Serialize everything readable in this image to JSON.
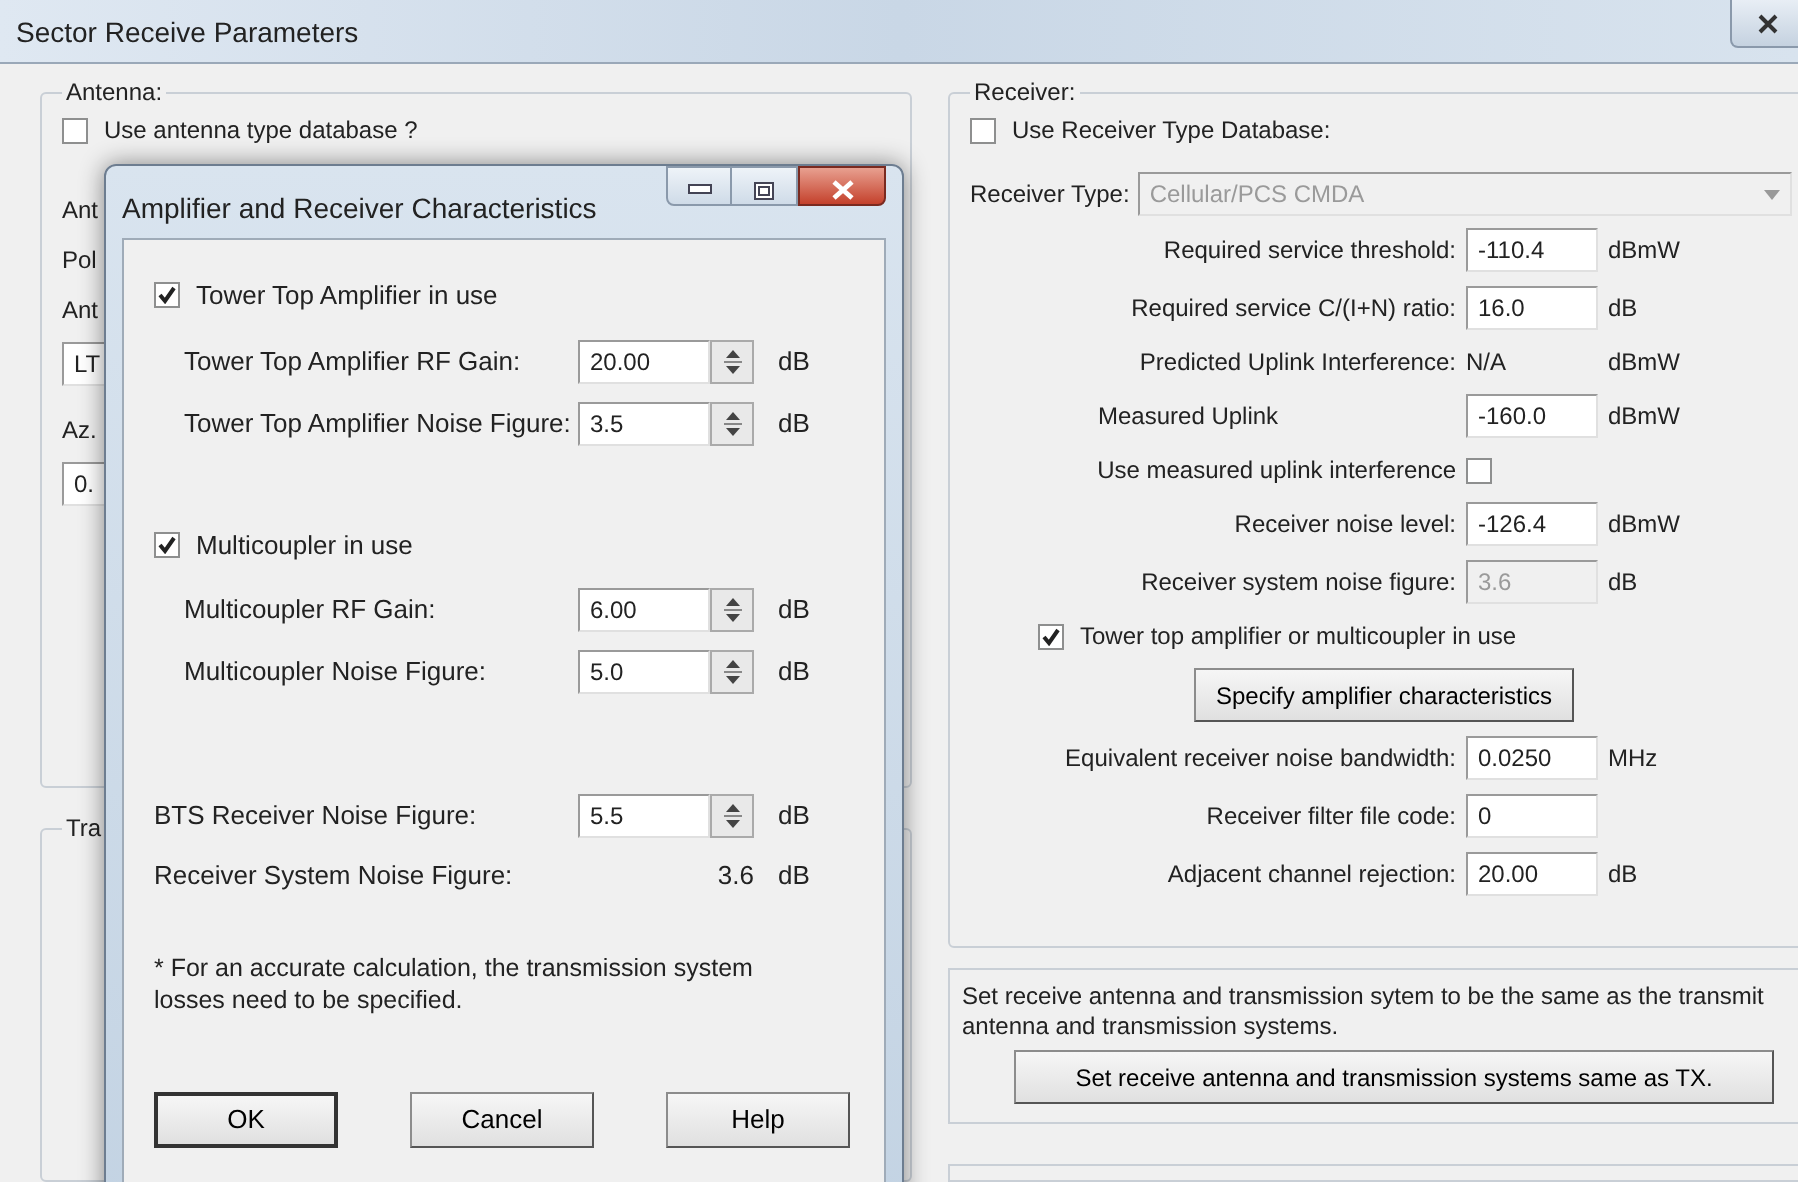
{
  "window": {
    "title": "Sector Receive Parameters"
  },
  "antenna": {
    "legend": "Antenna:",
    "use_database": {
      "label": "Use antenna type database ?",
      "checked": false
    },
    "partial_items": [
      {
        "kind": "label",
        "text": "Ant"
      },
      {
        "kind": "label",
        "text": "Pol"
      },
      {
        "kind": "label",
        "text": "Ant"
      },
      {
        "kind": "field",
        "text": "LT"
      },
      {
        "kind": "label",
        "text": "Az."
      },
      {
        "kind": "field",
        "text": "0."
      }
    ]
  },
  "transmission": {
    "legend": "Tra"
  },
  "receiver": {
    "legend": "Receiver:",
    "use_database": {
      "label": "Use Receiver Type Database:",
      "checked": false
    },
    "receiver_type": {
      "label": "Receiver Type:",
      "value": "Cellular/PCS CMDA",
      "disabled": true
    },
    "rows": [
      {
        "kind": "field",
        "label": "Required service threshold:",
        "value": "-110.4",
        "unit": "dBmW",
        "disabled": false
      },
      {
        "kind": "field",
        "label": "Required service C/(I+N) ratio:",
        "value": "16.0",
        "unit": "dB",
        "disabled": false
      },
      {
        "kind": "text",
        "label": "Predicted Uplink Interference:",
        "value": "N/A",
        "unit": "dBmW"
      },
      {
        "kind": "field",
        "label": "Measured Uplink",
        "value": "-160.0",
        "unit": "dBmW",
        "disabled": false
      },
      {
        "kind": "check-after",
        "label": "Use measured uplink interference",
        "checked": false
      },
      {
        "kind": "field",
        "label": "Receiver noise level:",
        "value": "-126.4",
        "unit": "dBmW",
        "disabled": false
      },
      {
        "kind": "field",
        "label": "Receiver system noise figure:",
        "value": "3.6",
        "unit": "dB",
        "disabled": true
      },
      {
        "kind": "check-before",
        "label": "Tower top amplifier or multicoupler in use",
        "checked": true
      },
      {
        "kind": "button",
        "label": "Specify amplifier characteristics"
      },
      {
        "kind": "field",
        "label": "Equivalent receiver noise bandwidth:",
        "value": "0.0250",
        "unit": "MHz",
        "disabled": false
      },
      {
        "kind": "field",
        "label": "Receiver filter file code:",
        "value": "0",
        "disabled": false
      },
      {
        "kind": "field",
        "label": "Adjacent channel rejection:",
        "value": "20.00",
        "unit": "dB",
        "disabled": false
      }
    ]
  },
  "same_as_tx": {
    "text": "Set receive antenna and transmission sytem to be the same as the transmit antenna and transmission systems.",
    "button": "Set receive antenna and transmission systems same as TX."
  },
  "dialog": {
    "title": "Amplifier and Receiver Characteristics",
    "sections": [
      {
        "checkbox": {
          "label": "Tower Top Amplifier in use",
          "checked": true
        },
        "rows": [
          {
            "label": "Tower Top Amplifier RF Gain:",
            "value": "20.00",
            "unit": "dB"
          },
          {
            "label": "Tower Top Amplifier Noise Figure:",
            "value": "3.5",
            "unit": "dB"
          }
        ]
      },
      {
        "checkbox": {
          "label": "Multicoupler in use",
          "checked": true
        },
        "rows": [
          {
            "label": "Multicoupler RF Gain:",
            "value": "6.00",
            "unit": "dB"
          },
          {
            "label": "Multicoupler Noise Figure:",
            "value": "5.0",
            "unit": "dB"
          }
        ]
      }
    ],
    "bts": {
      "label": "BTS Receiver Noise Figure:",
      "value": "5.5",
      "unit": "dB"
    },
    "system_nf": {
      "label": "Receiver System Noise Figure:",
      "value": "3.6",
      "unit": "dB"
    },
    "note": "* For an accurate calculation, the transmission system losses need to be specified.",
    "buttons": [
      {
        "label": "OK",
        "default": true
      },
      {
        "label": "Cancel",
        "default": false
      },
      {
        "label": "Help",
        "default": false
      }
    ]
  }
}
